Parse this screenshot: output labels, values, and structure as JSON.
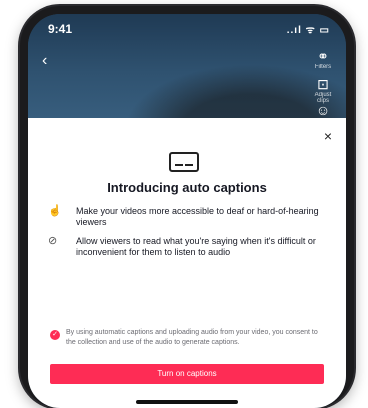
{
  "status_bar": {
    "time": "9:41",
    "icons": "..ıl ᯤ ▭"
  },
  "top_left": {
    "back_icon": "chevron-left-icon",
    "back_glyph": "‹"
  },
  "side_tools": [
    {
      "icon": "filters-icon",
      "glyph": "⚭",
      "label": "Filters"
    },
    {
      "icon": "adjust-clips-icon",
      "glyph": "⊡",
      "label": "Adjust clips"
    },
    {
      "icon": "voice-icon",
      "glyph": "☺",
      "label": ""
    }
  ],
  "sheet": {
    "close_glyph": "×",
    "title": "Introducing auto captions",
    "features": [
      {
        "icon": "accessibility-icon",
        "glyph": "☝",
        "text": "Make your videos more accessible to deaf or hard-of-hearing viewers"
      },
      {
        "icon": "sound-off-icon",
        "glyph": "⊘",
        "text": "Allow viewers to read what you're saying when it's difficult or inconvenient for them to listen to audio"
      }
    ],
    "consent": "By using automatic captions and uploading audio from your video, you consent to the collection and use of the audio to generate captions.",
    "cta_label": "Turn on captions"
  },
  "colors": {
    "accent": "#fe2c55",
    "watermark": "#3a8a3a"
  }
}
